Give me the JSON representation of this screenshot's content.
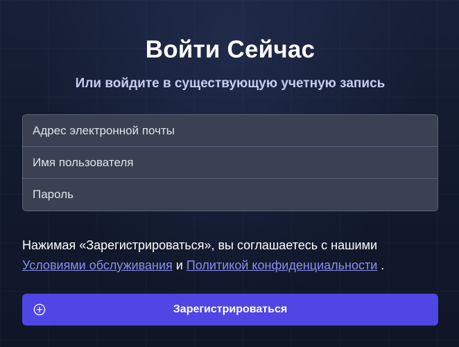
{
  "header": {
    "title": "Войти Сейчас",
    "subtitle": "Или войдите в существующую учетную запись"
  },
  "form": {
    "email_placeholder": "Адрес электронной почты",
    "username_placeholder": "Имя пользователя",
    "password_placeholder": "Пароль"
  },
  "terms": {
    "prefix": "Нажимая «Зарегистрироваться», вы соглашаетесь с нашими",
    "tos_link": "Условиями обслуживания",
    "conjunction": "и",
    "privacy_link": "Политикой конфиденциальности",
    "suffix": "."
  },
  "submit": {
    "label": "Зарегистрироваться",
    "icon": "plus-circle-icon"
  },
  "colors": {
    "accent": "#4f46e5",
    "link": "#8a90f0",
    "field_bg": "#394152"
  }
}
